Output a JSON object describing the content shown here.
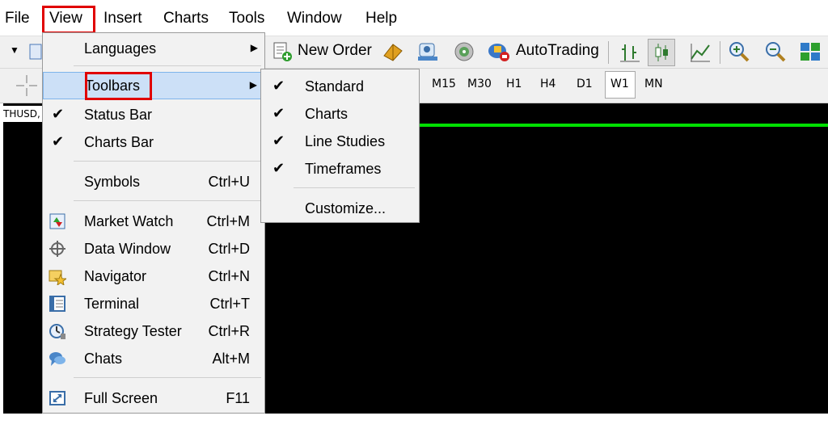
{
  "menubar": {
    "items": [
      "File",
      "View",
      "Insert",
      "Charts",
      "Tools",
      "Window",
      "Help"
    ]
  },
  "toolbar": {
    "new_order": "New Order",
    "autotrading": "AutoTrading",
    "timeframes": [
      "M15",
      "M30",
      "H1",
      "H4",
      "D1",
      "W1",
      "MN"
    ]
  },
  "chart": {
    "tab_label": "THUSD,"
  },
  "view_menu": {
    "items": [
      {
        "label": "Languages",
        "shortcut": "",
        "checked": false,
        "submenu": true
      },
      {
        "label": "Toolbars",
        "shortcut": "",
        "checked": false,
        "submenu": true
      },
      {
        "label": "Status Bar",
        "shortcut": "",
        "checked": true
      },
      {
        "label": "Charts Bar",
        "shortcut": "",
        "checked": true
      },
      {
        "label": "Symbols",
        "shortcut": "Ctrl+U"
      },
      {
        "label": "Market Watch",
        "shortcut": "Ctrl+M",
        "icon": "market-watch-icon"
      },
      {
        "label": "Data Window",
        "shortcut": "Ctrl+D",
        "icon": "data-window-icon"
      },
      {
        "label": "Navigator",
        "shortcut": "Ctrl+N",
        "icon": "navigator-icon"
      },
      {
        "label": "Terminal",
        "shortcut": "Ctrl+T",
        "icon": "terminal-icon"
      },
      {
        "label": "Strategy Tester",
        "shortcut": "Ctrl+R",
        "icon": "strategy-tester-icon"
      },
      {
        "label": "Chats",
        "shortcut": "Alt+M",
        "icon": "chats-icon"
      },
      {
        "label": "Full Screen",
        "shortcut": "F11",
        "icon": "full-screen-icon"
      }
    ]
  },
  "toolbars_submenu": {
    "items": [
      {
        "label": "Standard",
        "checked": true
      },
      {
        "label": "Charts",
        "checked": true
      },
      {
        "label": "Line Studies",
        "checked": true
      },
      {
        "label": "Timeframes",
        "checked": true
      },
      {
        "label": "Customize...",
        "checked": false
      }
    ]
  },
  "colors": {
    "highlight_box": "#e00000",
    "hover_row": "#cce0f7",
    "chart_bg": "#000000",
    "chart_line": "#00e000"
  }
}
